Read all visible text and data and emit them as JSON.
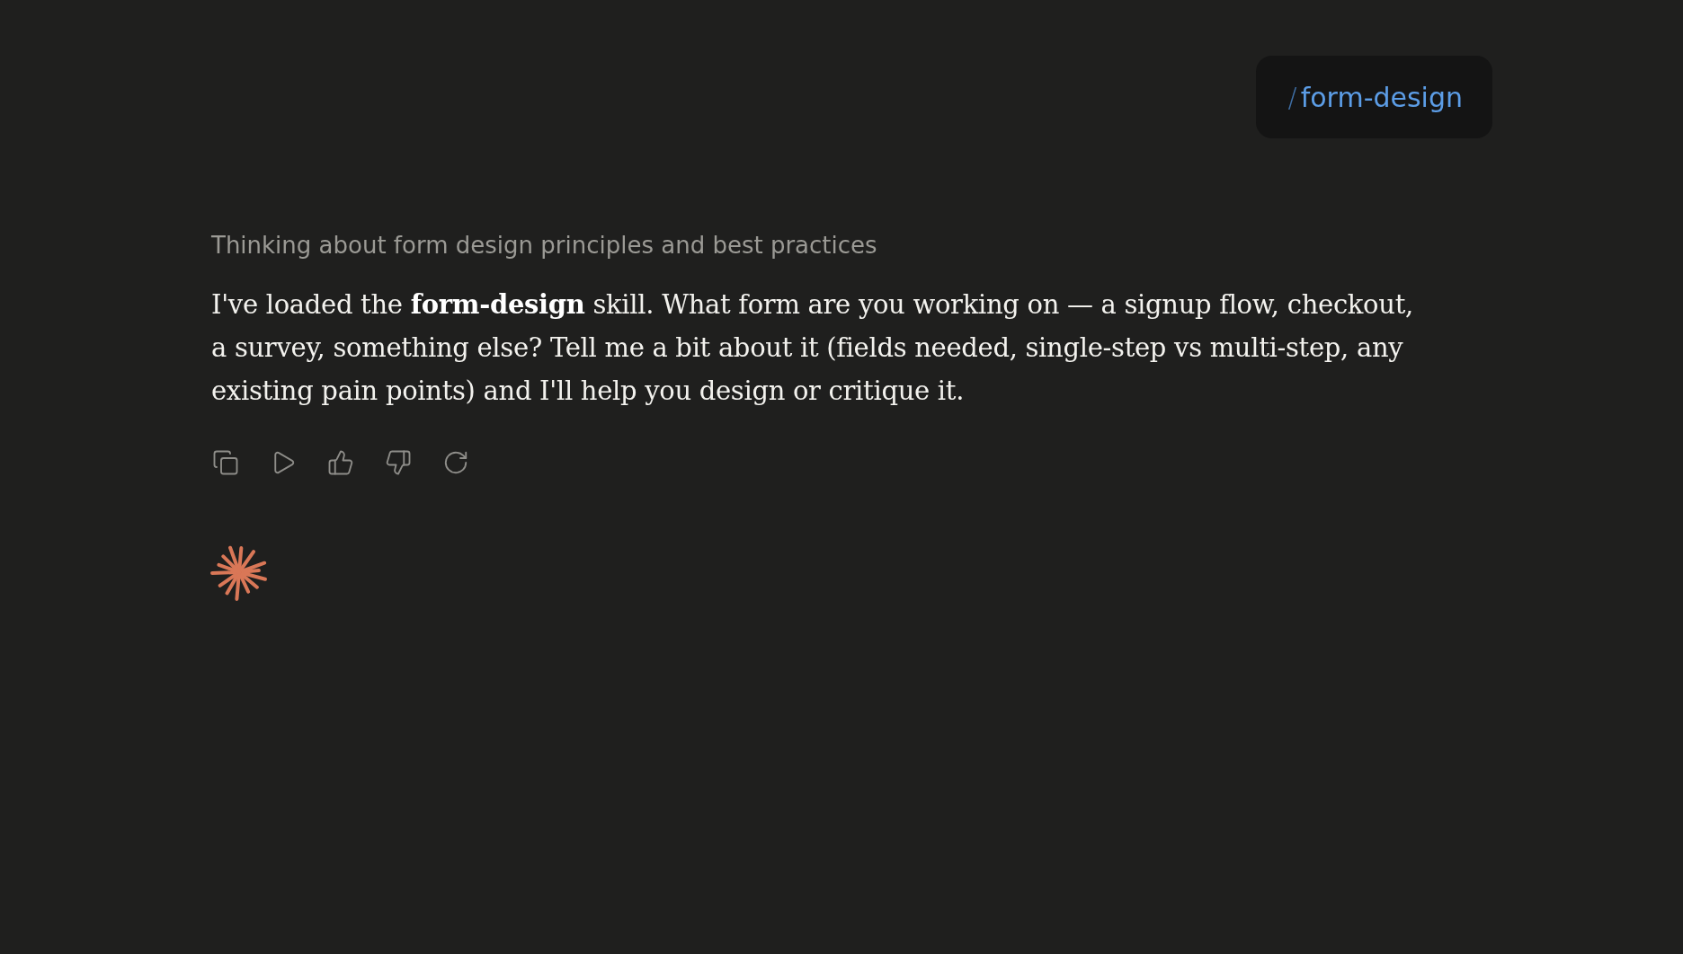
{
  "command_pill": {
    "prefix": "/",
    "name": "form-design"
  },
  "thinking_summary": "Thinking about form design principles and best practices",
  "message": {
    "text": "I've loaded the **form-design** skill. What form are you working on — a signup flow, checkout, a survey, something else? Tell me a bit about it (fields needed, single-step vs multi-step, any existing pain points) and I'll help you design or critique it."
  },
  "actions": [
    {
      "kind": "copy"
    },
    {
      "kind": "play"
    },
    {
      "kind": "thumbs_up"
    },
    {
      "kind": "thumbs_down"
    },
    {
      "kind": "retry"
    }
  ]
}
